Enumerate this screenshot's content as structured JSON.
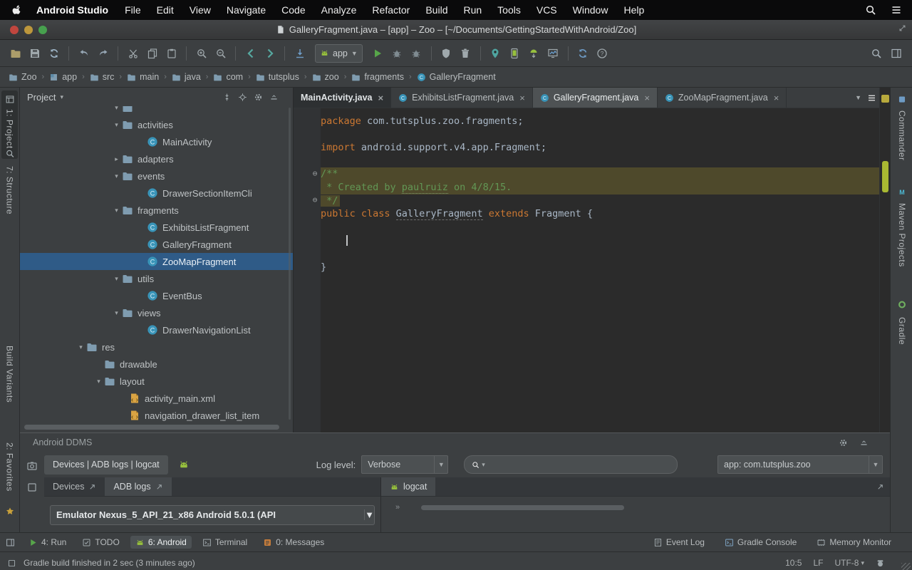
{
  "menubar": {
    "app_name": "Android Studio",
    "items": [
      "File",
      "Edit",
      "View",
      "Navigate",
      "Code",
      "Analyze",
      "Refactor",
      "Build",
      "Run",
      "Tools",
      "VCS",
      "Window",
      "Help"
    ]
  },
  "titlebar": {
    "title": "GalleryFragment.java – [app] – Zoo – [~/Documents/GettingStartedWithAndroid/Zoo]"
  },
  "toolbar": {
    "run_config": "app",
    "icons": [
      "open",
      "save",
      "refresh",
      "sep",
      "undo",
      "redo",
      "sep",
      "cut",
      "copy",
      "paste",
      "sep",
      "zoom-in",
      "zoom-out",
      "sep",
      "back",
      "forward",
      "sep",
      "update",
      "run-config-combo",
      "run",
      "debug",
      "attach",
      "sep",
      "coverage",
      "gc",
      "sep",
      "pin",
      "avd",
      "sdk",
      "monitor",
      "sep",
      "sync",
      "help"
    ]
  },
  "breadcrumbs": [
    {
      "label": "Zoo",
      "icon": "folder"
    },
    {
      "label": "app",
      "icon": "module"
    },
    {
      "label": "src",
      "icon": "folder"
    },
    {
      "label": "main",
      "icon": "folder"
    },
    {
      "label": "java",
      "icon": "folder"
    },
    {
      "label": "com",
      "icon": "folder"
    },
    {
      "label": "tutsplus",
      "icon": "folder"
    },
    {
      "label": "zoo",
      "icon": "folder"
    },
    {
      "label": "fragments",
      "icon": "folder"
    },
    {
      "label": "GalleryFragment",
      "icon": "class"
    }
  ],
  "stripes": {
    "left": [
      {
        "label": "1: Project",
        "icon": "window"
      },
      {
        "label": "7: Structure",
        "icon": "magnifier"
      },
      {
        "label": "Build Variants"
      },
      {
        "label": "2: Favorites",
        "icon_after": "star"
      }
    ],
    "right": [
      {
        "label": "Commander",
        "icon": "commander"
      },
      {
        "label": "Maven Projects",
        "icon": "maven"
      },
      {
        "label": "Gradle",
        "icon": "gradle"
      }
    ]
  },
  "project": {
    "header": "Project",
    "tree": [
      {
        "label": "",
        "icon": "folder",
        "arrow": "down",
        "indent": 128,
        "clipped": true
      },
      {
        "label": "activities",
        "icon": "folder",
        "arrow": "down",
        "indent": 128
      },
      {
        "label": "MainActivity",
        "icon": "class",
        "indent": 163
      },
      {
        "label": "adapters",
        "icon": "folder",
        "arrow": "right",
        "indent": 128
      },
      {
        "label": "events",
        "icon": "folder",
        "arrow": "down",
        "indent": 128
      },
      {
        "label": "DrawerSectionItemCli",
        "icon": "class",
        "indent": 163
      },
      {
        "label": "fragments",
        "icon": "folder",
        "arrow": "down",
        "indent": 128
      },
      {
        "label": "ExhibitsListFragment",
        "icon": "class",
        "indent": 163
      },
      {
        "label": "GalleryFragment",
        "icon": "class",
        "indent": 163
      },
      {
        "label": "ZooMapFragment",
        "icon": "class",
        "indent": 163,
        "selected": true
      },
      {
        "label": "utils",
        "icon": "folder",
        "arrow": "down",
        "indent": 128
      },
      {
        "label": "EventBus",
        "icon": "class",
        "indent": 163
      },
      {
        "label": "views",
        "icon": "folder",
        "arrow": "down",
        "indent": 128
      },
      {
        "label": "DrawerNavigationList",
        "icon": "class",
        "indent": 163
      },
      {
        "label": "res",
        "icon": "folder",
        "arrow": "down",
        "indent": 78
      },
      {
        "label": "drawable",
        "icon": "folder",
        "indent": 103
      },
      {
        "label": "layout",
        "icon": "folder",
        "arrow": "down",
        "indent": 103
      },
      {
        "label": "activity_main.xml",
        "icon": "xml",
        "indent": 138
      },
      {
        "label": "navigation_drawer_list_item",
        "icon": "xml",
        "indent": 138
      }
    ]
  },
  "editor": {
    "tabs": [
      {
        "label": "MainActivity.java",
        "dark": true
      },
      {
        "label": "ExhibitsListFragment.java",
        "icon": "class"
      },
      {
        "label": "GalleryFragment.java",
        "icon": "class",
        "active": true
      },
      {
        "label": "ZooMapFragment.java",
        "icon": "class"
      }
    ],
    "code_lines": [
      {
        "tokens": [
          [
            "k",
            "package"
          ],
          [
            "p",
            " com.tutsplus.zoo.fragments;"
          ]
        ]
      },
      {
        "tokens": []
      },
      {
        "tokens": [
          [
            "k",
            "import"
          ],
          [
            "p",
            " android.support.v4.app.Fragment;"
          ]
        ]
      },
      {
        "tokens": []
      },
      {
        "hl": "full",
        "fold": true,
        "tokens": [
          [
            "d",
            "/**"
          ]
        ]
      },
      {
        "hl": "full",
        "tokens": [
          [
            "d",
            " * Created by "
          ],
          [
            "du",
            "paulruiz"
          ],
          [
            "d",
            " on 4/8/15."
          ]
        ]
      },
      {
        "hl": "text",
        "fold": true,
        "tokens": [
          [
            "d",
            " */"
          ]
        ]
      },
      {
        "tokens": [
          [
            "k",
            "public class "
          ],
          [
            "cu",
            "GalleryFragment"
          ],
          [
            "k",
            " extends "
          ],
          [
            "p",
            "Fragment"
          ],
          [
            "p",
            " {"
          ]
        ]
      },
      {
        "tokens": []
      },
      {
        "caret": true,
        "tokens": []
      },
      {
        "tokens": []
      },
      {
        "tokens": [
          [
            "p",
            "}"
          ]
        ]
      }
    ]
  },
  "ddms": {
    "title": "Android DDMS",
    "tab": "Devices | ADB logs | logcat",
    "log_level_label": "Log level:",
    "log_level": "Verbose",
    "app_filter": "app: com.tutsplus.zoo",
    "left_tabs": [
      "Devices",
      "ADB logs"
    ],
    "device": "Emulator Nexus_5_API_21_x86 Android 5.0.1 (API",
    "logcat_tab": "logcat"
  },
  "toolwindows": {
    "left": [
      {
        "label": "4: Run",
        "icon": "play"
      },
      {
        "label": "TODO",
        "icon": "todo"
      },
      {
        "label": "6: Android",
        "icon": "android",
        "active": true
      },
      {
        "label": "Terminal",
        "icon": "terminal"
      },
      {
        "label": "0: Messages",
        "icon": "messages"
      }
    ],
    "right": [
      {
        "label": "Event Log",
        "icon": "eventlog"
      },
      {
        "label": "Gradle Console",
        "icon": "gconsole"
      },
      {
        "label": "Memory Monitor",
        "icon": "memory"
      }
    ]
  },
  "status": {
    "message": "Gradle build finished in 2 sec (3 minutes ago)",
    "caret_pos": "10:5",
    "line_sep": "LF",
    "encoding": "UTF-8"
  }
}
